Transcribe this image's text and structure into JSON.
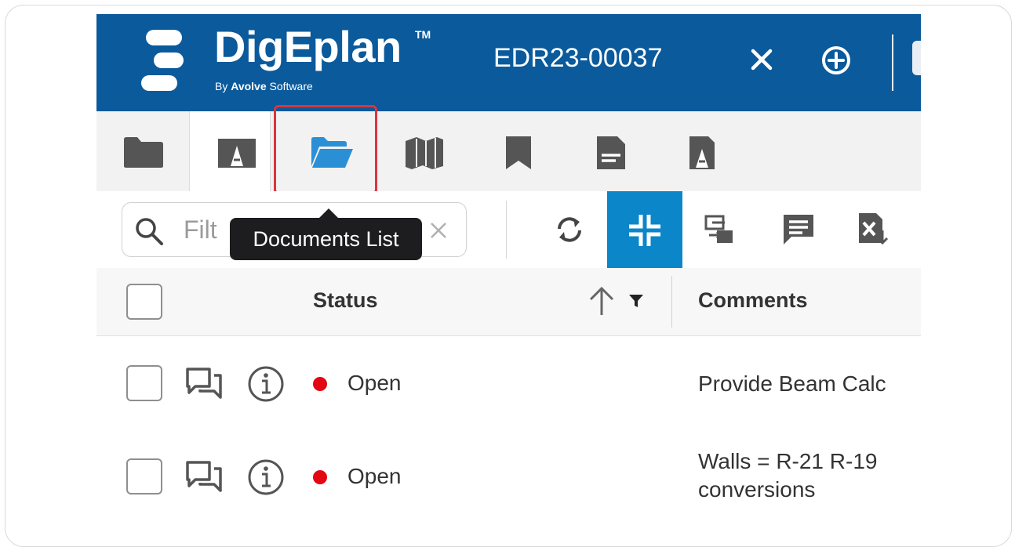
{
  "header": {
    "brand": "DigEplan",
    "trademark": "TM",
    "byline_prefix": "By ",
    "byline_company": "Avolve",
    "byline_suffix": " Software",
    "record_id": "EDR23-00037"
  },
  "tooltip": {
    "text": "Documents List"
  },
  "search": {
    "placeholder": "Filt"
  },
  "table": {
    "columns": [
      "Status",
      "Comments"
    ],
    "rows": [
      {
        "status": "Open",
        "comment_lines": [
          "Provide Beam Calc"
        ]
      },
      {
        "status": "Open",
        "comment_lines": [
          "Walls = R-21 R-19 ",
          "conversions"
        ]
      }
    ]
  },
  "colors": {
    "header_bg": "#0a5a9c",
    "active_tool": "#0b86c9",
    "status_open": "#e30613",
    "highlight_border": "#d9363e",
    "active_tab_icon": "#2b8fd6"
  }
}
